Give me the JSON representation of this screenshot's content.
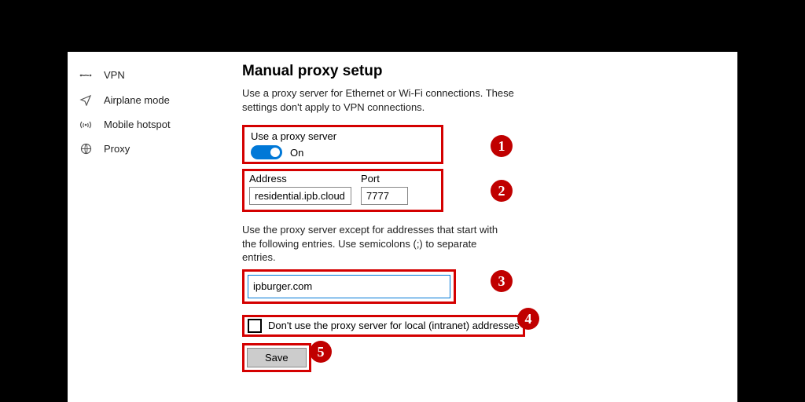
{
  "sidebar": {
    "items": [
      {
        "label": "VPN",
        "icon": "vpn"
      },
      {
        "label": "Airplane mode",
        "icon": "airplane"
      },
      {
        "label": "Mobile hotspot",
        "icon": "hotspot"
      },
      {
        "label": "Proxy",
        "icon": "proxy"
      }
    ]
  },
  "main": {
    "title": "Manual proxy setup",
    "description": "Use a proxy server for Ethernet or Wi-Fi connections. These settings don't apply to VPN connections.",
    "use_proxy_label": "Use a proxy server",
    "toggle_state": "On",
    "address_label": "Address",
    "address_value": "residential.ipb.cloud",
    "port_label": "Port",
    "port_value": "7777",
    "except_description": "Use the proxy server except for addresses that start with the following entries. Use semicolons (;) to separate entries.",
    "except_value": "ipburger.com",
    "bypass_local_label": "Don't use the proxy server for local (intranet) addresses",
    "bypass_local_checked": false,
    "save_label": "Save"
  },
  "annotations": {
    "badges": [
      "1",
      "2",
      "3",
      "4",
      "5"
    ],
    "highlight_color": "#d40000"
  }
}
